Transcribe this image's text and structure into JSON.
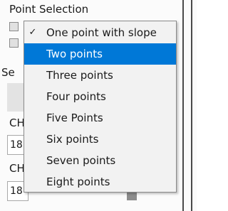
{
  "panel": {
    "title": "Point Selection",
    "section_label_partial": "Se",
    "ch_label_1_partial": "CH",
    "ch_input_1_partial": "18",
    "ch_label_2_partial": "CH",
    "ch_input_2_partial": "18"
  },
  "dropdown": {
    "check_mark": "✓",
    "checked_index": 0,
    "highlighted_index": 1,
    "items": [
      {
        "label": "One point with slope"
      },
      {
        "label": "Two points"
      },
      {
        "label": "Three points"
      },
      {
        "label": "Four points"
      },
      {
        "label": "Five Points"
      },
      {
        "label": "Six points"
      },
      {
        "label": "Seven points"
      },
      {
        "label": "Eight points"
      }
    ]
  },
  "colors": {
    "highlight": "#0078d7",
    "menu_background": "#f2f2f2"
  }
}
